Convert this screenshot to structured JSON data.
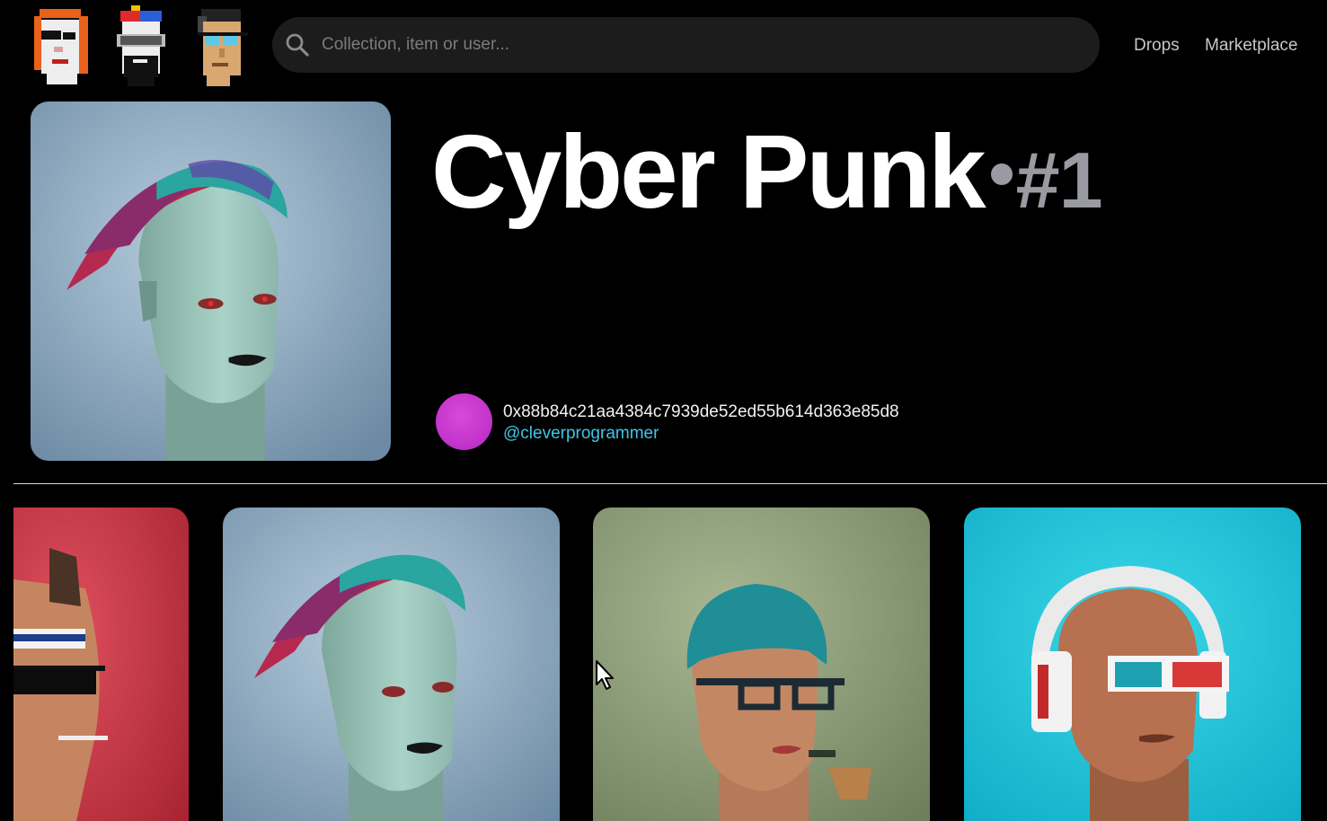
{
  "header": {
    "logo_icons": [
      "punk-redhair-icon",
      "punk-propeller-cap-icon",
      "punk-glasses-icon"
    ],
    "search": {
      "placeholder": "Collection, item or user...",
      "value": "",
      "icon": "search-icon"
    },
    "nav": [
      {
        "label": "Drops"
      },
      {
        "label": "Marketplace"
      }
    ]
  },
  "nft": {
    "title": "Cyber Punk",
    "number": "#1",
    "image": "mohawk-voxel-head-image",
    "owner": {
      "address": "0x88b84c21aa4384c7939de52ed55b614d363e85d8",
      "handle": "@cleverprogrammer"
    }
  },
  "gallery": [
    {
      "image": "sunglasses-cigarette-voxel-head",
      "background": "#c83c4a"
    },
    {
      "image": "mohawk-voxel-head",
      "background": "#7f9cb4"
    },
    {
      "image": "beanie-pipe-voxel-head",
      "background": "#8e9e78"
    },
    {
      "image": "headphones-3d-glasses-voxel-head",
      "background": "#16c4dc"
    }
  ],
  "colors": {
    "background": "#000000",
    "accent_link": "#3ec6e8",
    "avatar": "#c433d0",
    "muted": "#9a9aa2"
  }
}
